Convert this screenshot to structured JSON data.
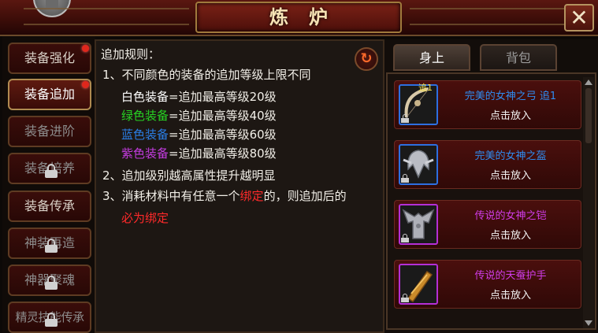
{
  "window": {
    "title": "炼炉",
    "close_glyph": "✕"
  },
  "nav": {
    "items": [
      {
        "label": "装备强化",
        "badge": true,
        "locked": false
      },
      {
        "label": "装备追加",
        "badge": true,
        "locked": false,
        "active": true
      },
      {
        "label": "装备进阶",
        "badge": false,
        "locked": false
      },
      {
        "label": "装备培养",
        "badge": false,
        "locked": true
      },
      {
        "label": "装备传承",
        "badge": false,
        "locked": false
      },
      {
        "label": "神装再造",
        "badge": false,
        "locked": true
      },
      {
        "label": "神器聚魂",
        "badge": false,
        "locked": true
      },
      {
        "label": "精灵技能传承",
        "badge": false,
        "locked": true
      }
    ]
  },
  "rules": {
    "heading": "追加规则：",
    "rule1": "1、不同颜色的装备的追加等级上限不同",
    "white_name": "白色装备",
    "white_text": "=追加最高等级20级",
    "green_name": "绿色装备",
    "green_text": "=追加最高等级40级",
    "blue_name": "蓝色装备",
    "blue_text": "=追加最高等级60级",
    "purple_name": "紫色装备",
    "purple_text": "=追加最高等级80级",
    "rule2": "2、追加级别越高属性提升越明显",
    "rule3_a": "3、消耗材料中有任意一个",
    "rule3_bound": "绑定",
    "rule3_b": "的，则追加后的",
    "rule3_tail": "必为绑定",
    "refresh_glyph": "↻"
  },
  "tabs": {
    "equipped": "身上",
    "bag": "背包"
  },
  "items": [
    {
      "name": "完美的女神之弓 追1",
      "level": "追1",
      "action": "点击放入",
      "name_color": "#2f8cf0",
      "rarity": "blue",
      "icon": "bow-icon"
    },
    {
      "name": "完美的女神之盔",
      "action": "点击放入",
      "name_color": "#2f8cf0",
      "rarity": "blue",
      "icon": "helmet-icon"
    },
    {
      "name": "传说的女神之铠",
      "action": "点击放入",
      "name_color": "#cf3ce8",
      "rarity": "purple",
      "icon": "armor-icon"
    },
    {
      "name": "传说的天蚕护手",
      "action": "点击放入",
      "name_color": "#cf3ce8",
      "rarity": "purple",
      "icon": "gauntlet-icon"
    }
  ],
  "colors": {
    "accent_gold": "#b08a50",
    "badge_red": "#e0271c",
    "bound_red": "#ff2a2a"
  }
}
